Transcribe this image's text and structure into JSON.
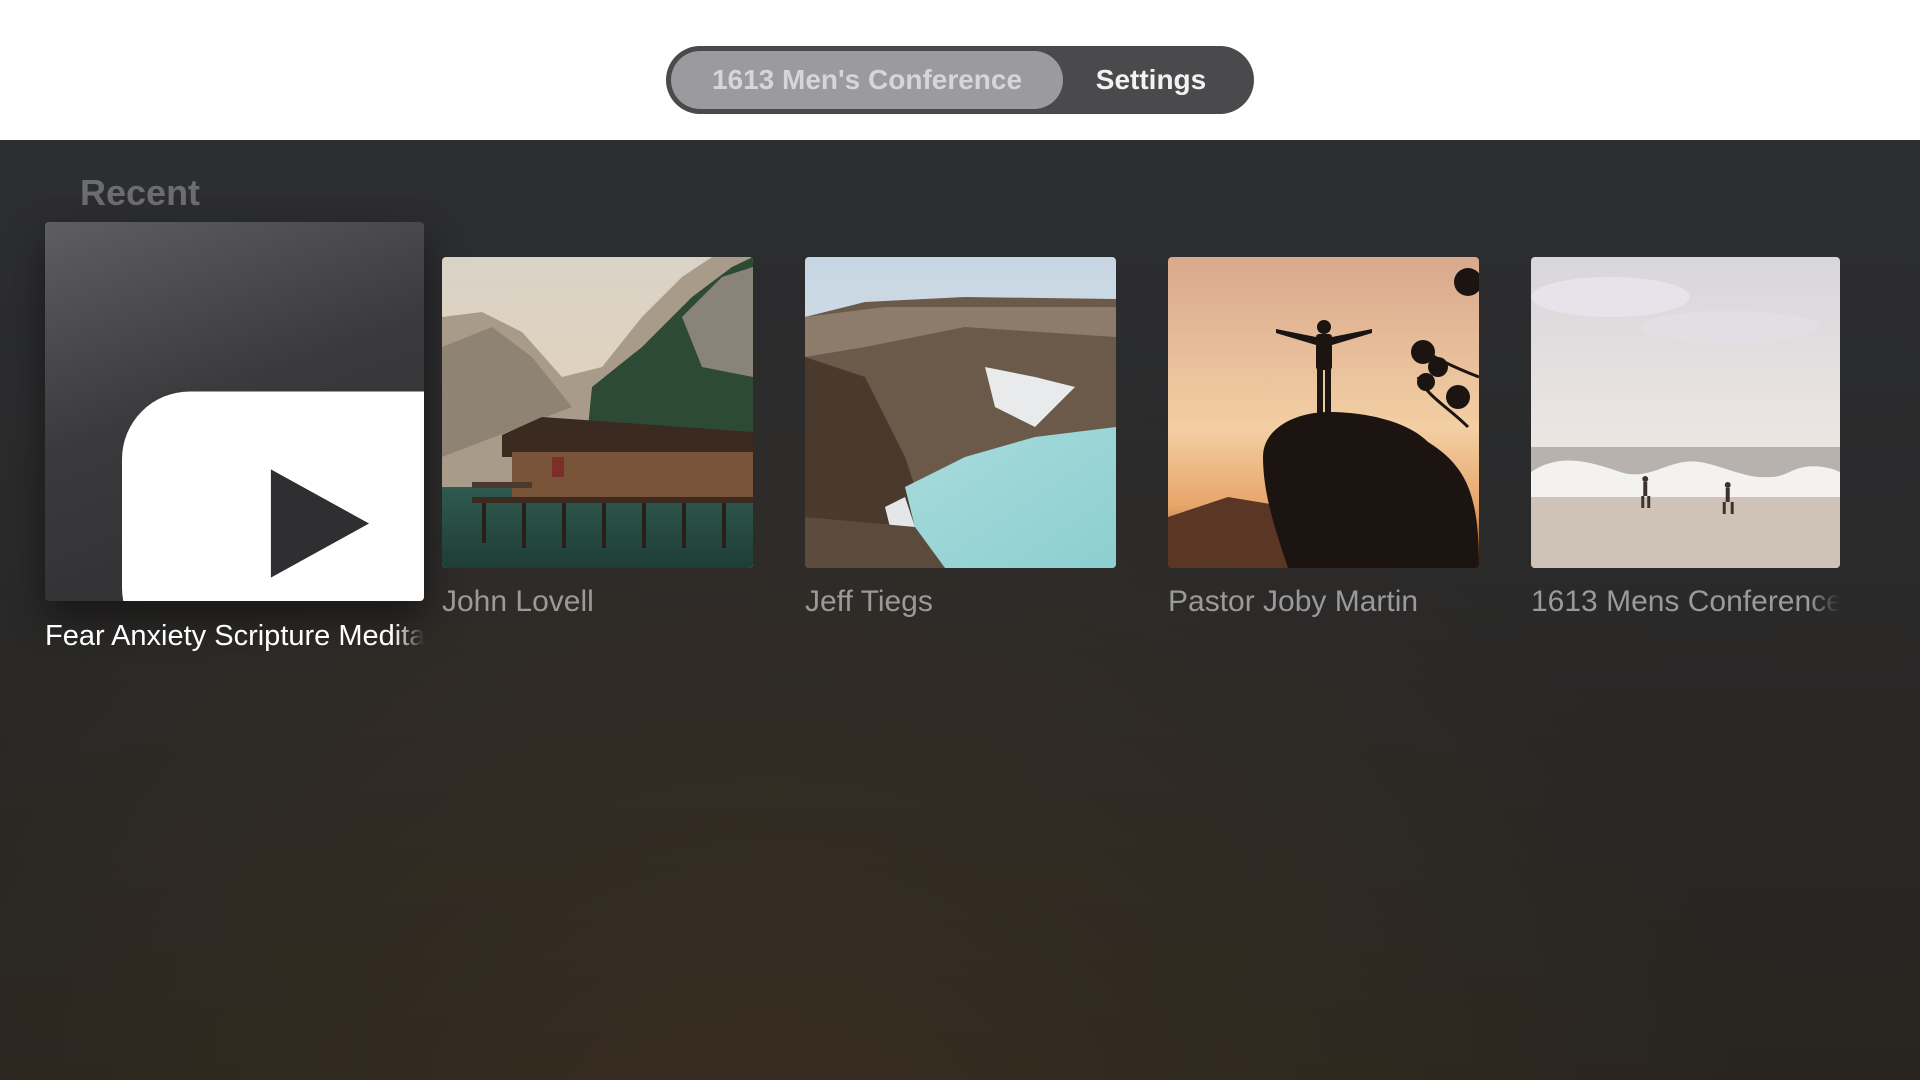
{
  "tabs": [
    {
      "label": "1613 Men's Conference",
      "selected": true
    },
    {
      "label": "Settings",
      "selected": false
    }
  ],
  "section": {
    "title": "Recent"
  },
  "items": [
    {
      "title": "Fear Anxiety Scripture Meditation",
      "thumbnail": "youtube-play-icon",
      "focused": true
    },
    {
      "title": "John Lovell",
      "thumbnail": "lake-cabin-mountains-photo",
      "focused": false
    },
    {
      "title": "Jeff Tiegs",
      "thumbnail": "crater-lake-photo",
      "focused": false
    },
    {
      "title": "Pastor Joby Martin",
      "thumbnail": "man-on-rock-sunset-photo",
      "focused": false
    },
    {
      "title": "1613 Mens Conference",
      "thumbnail": "beach-waves-runners-photo",
      "focused": false
    }
  ],
  "colors": {
    "header_bg": "#ffffff",
    "tab_bar_bg": "#4a4a4c",
    "tab_selected_bg": "#9b9b9d",
    "content_bg": "#2b2b2d",
    "caption": "#9a9a9c",
    "caption_focused": "#ffffff"
  }
}
